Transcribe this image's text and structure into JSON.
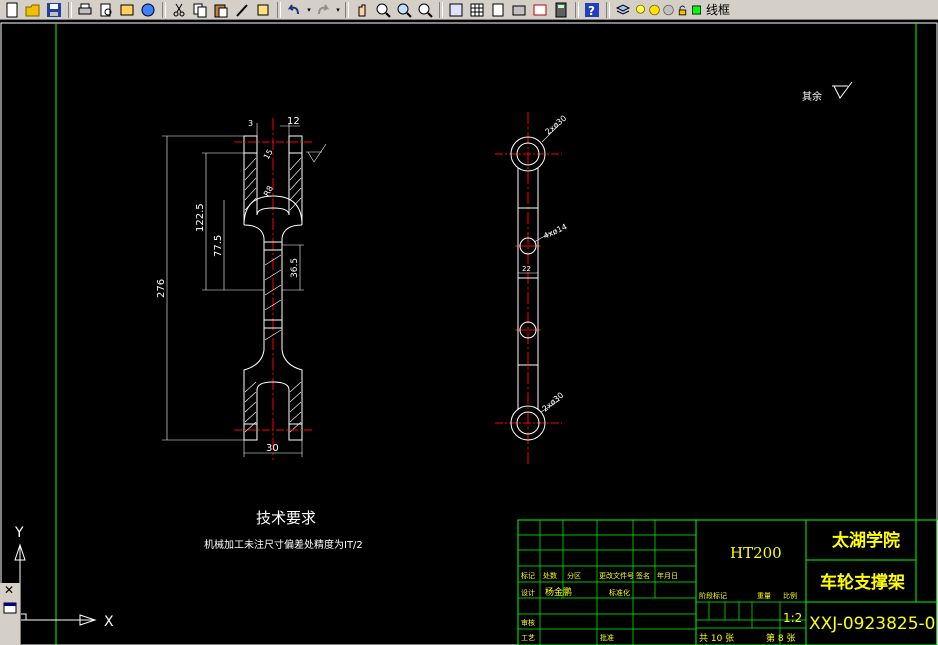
{
  "toolbar": {
    "icons": [
      "new-icon",
      "open-icon",
      "save-icon",
      "print-icon",
      "print-preview-icon",
      "publish-icon",
      "3d-dwf-icon",
      "cut-icon",
      "copy-icon",
      "paste-icon",
      "match-properties-icon",
      "block-editor-icon",
      "undo-icon",
      "redo-icon",
      "pan-icon",
      "zoom-realtime-icon",
      "zoom-window-icon",
      "zoom-previous-icon",
      "properties-icon",
      "design-center-icon",
      "tool-palettes-icon",
      "sheet-set-icon",
      "markup-icon",
      "quickcalc-icon",
      "help-icon",
      "layer-manager-icon",
      "lightbulb-icon",
      "sun-icon",
      "freeze-icon",
      "lock-icon",
      "color-swatch-icon"
    ],
    "layer_name": "线框"
  },
  "drawing": {
    "surface_roughness_note": "其余",
    "tech_requirements_title": "技术要求",
    "tech_requirements_text": "机械加工未注尺寸偏差处精度为IT/2",
    "left_view": {
      "dims": {
        "overall_length": "276",
        "length_122_5": "122.5",
        "length_77_5": "77.5",
        "length_36_5": "36.5",
        "fork_gap": "12",
        "bottom_width": "30",
        "top_small": "3",
        "r_label": "R8",
        "side_small": "15"
      }
    },
    "right_view": {
      "dims": {
        "top_hole": "2xø30",
        "mid_holes": "4xø14",
        "mid_spacing": "22",
        "bottom_hole": "2xø30"
      }
    },
    "title_block": {
      "material": "HT200",
      "school": "太湖学院",
      "part_name": "车轮支撑架",
      "drawing_no": "XXJ-0923825-0",
      "scale": "1:2",
      "designer_label": "设计",
      "designer": "杨金鹏",
      "standard_label": "标准化",
      "process_label": "工艺",
      "audit_label": "审核",
      "approve_label": "批准",
      "row_labels": [
        "标记",
        "处数",
        "分区",
        "更改文件号",
        "签名",
        "年月日"
      ],
      "stage_label": "阶段标记",
      "weight_label": "重量",
      "ratio_label": "比例",
      "sheets_total": "共 10 张",
      "sheet_no": "第 8 张"
    },
    "ucs": {
      "x_label": "X",
      "y_label": "Y"
    }
  }
}
